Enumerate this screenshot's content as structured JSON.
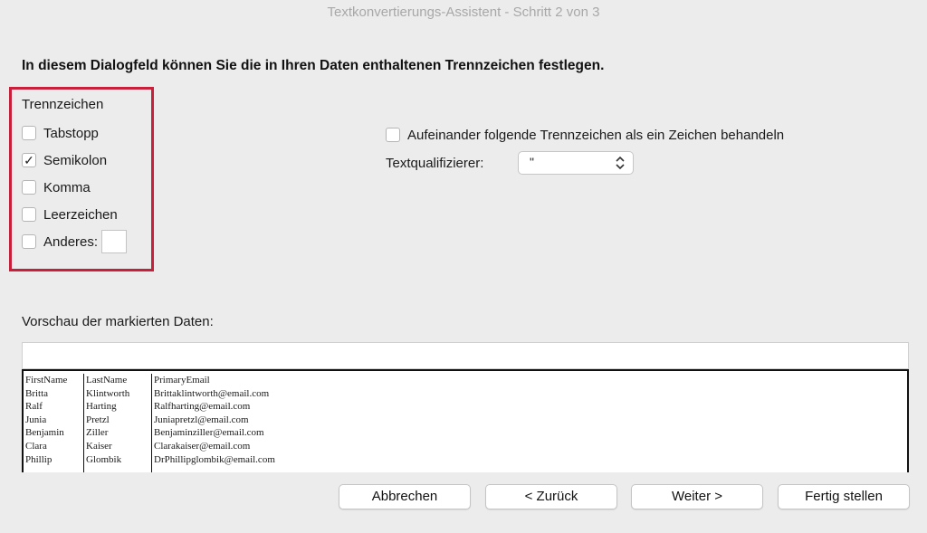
{
  "window": {
    "title": "Textkonvertierungs-Assistent - Schritt 2 von 3"
  },
  "heading": "In diesem Dialogfeld können Sie die in Ihren Daten enthaltenen Trennzeichen festlegen.",
  "delimiters": {
    "group_label": "Trennzeichen",
    "items": [
      {
        "label": "Tabstopp",
        "checked": false
      },
      {
        "label": "Semikolon",
        "checked": true
      },
      {
        "label": "Komma",
        "checked": false
      },
      {
        "label": "Leerzeichen",
        "checked": false
      },
      {
        "label": "Anderes:",
        "checked": false
      }
    ],
    "other_value": ""
  },
  "consecutive": {
    "label": "Aufeinander folgende Trennzeichen als ein Zeichen behandeln",
    "checked": false
  },
  "qualifier": {
    "label": "Textqualifizierer:",
    "value": "\""
  },
  "preview": {
    "label": "Vorschau der markierten Daten:",
    "columns": [
      [
        "FirstName",
        "Britta",
        "Ralf",
        "Junia",
        "Benjamin",
        "Clara",
        "Phillip"
      ],
      [
        "LastName",
        "Klintworth",
        "Harting",
        "Pretzl",
        "Ziller",
        "Kaiser",
        "Glombik"
      ],
      [
        "PrimaryEmail",
        "Brittaklintworth@email.com",
        "Ralfharting@email.com",
        "Juniapretzl@email.com",
        "Benjaminziller@email.com",
        "Clarakaiser@email.com",
        "DrPhillipglombik@email.com"
      ]
    ]
  },
  "buttons": {
    "cancel": "Abbrechen",
    "back": "< Zurück",
    "next": "Weiter >",
    "finish": "Fertig stellen"
  },
  "colors": {
    "highlight": "#c8203a",
    "background": "#ececec"
  }
}
